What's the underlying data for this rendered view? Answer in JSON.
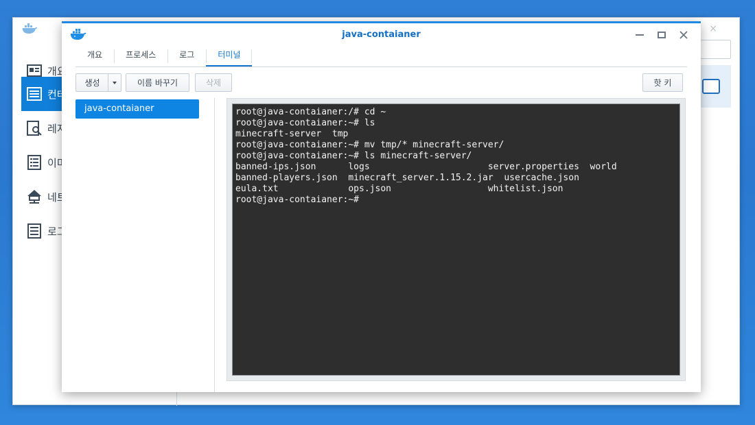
{
  "background_window": {
    "nav_items": [
      {
        "label": "개요",
        "icon": "overview-card-icon"
      },
      {
        "label": "컨테",
        "icon": "container-list-icon",
        "active": true
      },
      {
        "label": "레지",
        "icon": "registry-search-icon"
      },
      {
        "label": "이미",
        "icon": "image-list-icon"
      },
      {
        "label": "네트",
        "icon": "network-icon"
      },
      {
        "label": "로그",
        "icon": "log-list-icon"
      }
    ]
  },
  "window": {
    "title": "java-contaianer",
    "controls": {
      "minimize": "minimize-icon",
      "maximize": "maximize-icon",
      "close": "close-icon"
    }
  },
  "tabs": [
    "개요",
    "프로세스",
    "로그",
    "터미널"
  ],
  "active_tab": "터미널",
  "toolbar": {
    "create_label": "생성",
    "rename_label": "이름 바꾸기",
    "delete_label": "삭제",
    "hotkey_label": "핫 키"
  },
  "sessions": [
    "java-contaianer"
  ],
  "terminal": {
    "lines": [
      "root@java-contaianer:/# cd ~",
      "root@java-contaianer:~# ls",
      "minecraft-server  tmp",
      "root@java-contaianer:~# mv tmp/* minecraft-server/",
      "root@java-contaianer:~# ls minecraft-server/",
      "banned-ips.json      logs                      server.properties  world",
      "banned-players.json  minecraft_server.1.15.2.jar  usercache.json",
      "eula.txt             ops.json                  whitelist.json",
      "root@java-contaianer:~#"
    ]
  },
  "colors": {
    "accent": "#1477cf",
    "selection": "#0f85e3",
    "terminal_bg": "#2e2e2e",
    "terminal_fg": "#f2f2f2",
    "desktop": "#2f7fd6"
  }
}
